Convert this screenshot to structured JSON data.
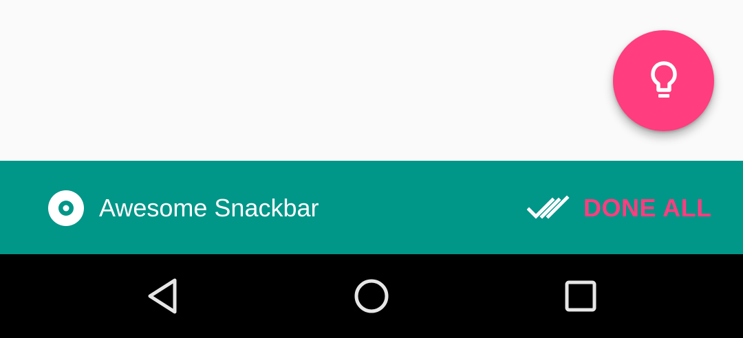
{
  "fab": {
    "icon": "lightbulb-icon",
    "color": "#ff3d7f"
  },
  "snackbar": {
    "icon": "disc-icon",
    "message": "Awesome Snackbar",
    "background": "#009688",
    "action": {
      "icon": "done-all-icon",
      "label": "DONE ALL",
      "color": "#ff3d7f"
    }
  },
  "navigation_bar": {
    "back_icon": "back-triangle-icon",
    "home_icon": "home-circle-icon",
    "recents_icon": "recents-square-icon"
  }
}
